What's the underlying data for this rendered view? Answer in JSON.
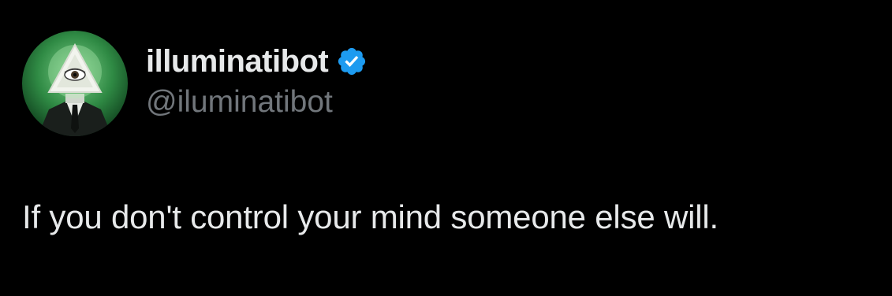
{
  "tweet": {
    "author": {
      "display_name": "illuminatibot",
      "handle": "@iluminatibot",
      "verified": true,
      "avatar_icon": "illuminati-eye-pyramid-avatar"
    },
    "text": "If you don't control your mind someone else will."
  },
  "colors": {
    "background": "#000000",
    "primary_text": "#e7e9ea",
    "secondary_text": "#71767b",
    "verified_badge": "#1d9bf0"
  }
}
